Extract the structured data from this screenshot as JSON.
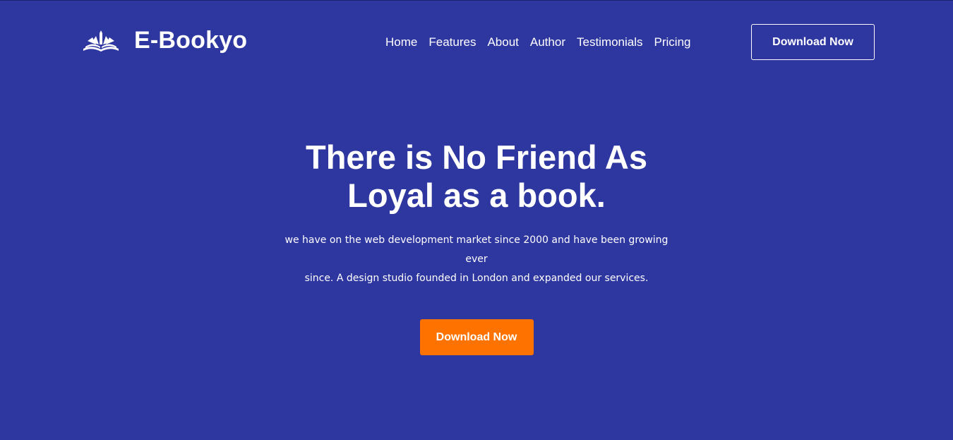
{
  "brand": {
    "name": "E-Bookyo",
    "icon": "open-book-icon"
  },
  "nav": {
    "items": [
      {
        "label": "Home"
      },
      {
        "label": "Features"
      },
      {
        "label": "About"
      },
      {
        "label": "Author"
      },
      {
        "label": "Testimonials"
      },
      {
        "label": "Pricing"
      }
    ],
    "cta_label": "Download Now"
  },
  "hero": {
    "title_line1": "There is No Friend As",
    "title_line2": "Loyal as a book.",
    "description_line1": "we have on the web development market since 2000 and have been growing ever",
    "description_line2": "since. A design studio founded in London and expanded our services.",
    "cta_label": "Download Now"
  },
  "colors": {
    "background": "#2e36a0",
    "accent": "#fe7300",
    "text": "#ffffff"
  }
}
